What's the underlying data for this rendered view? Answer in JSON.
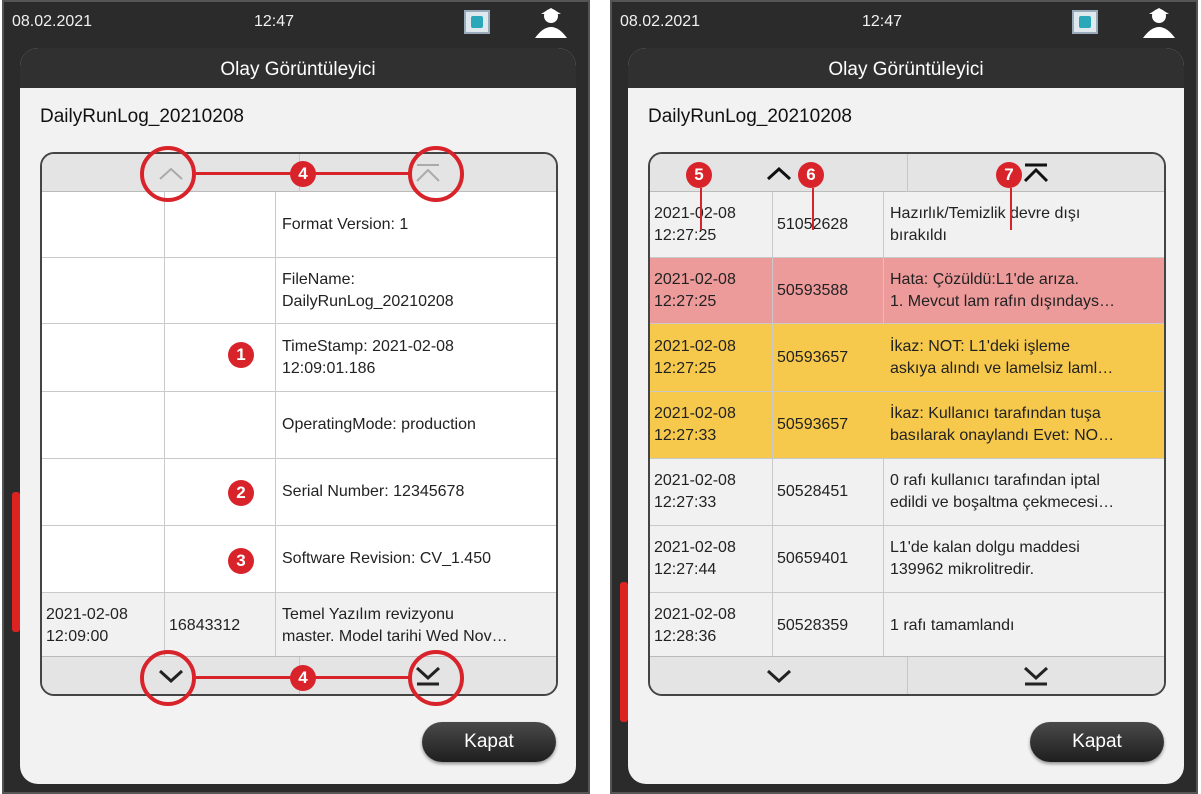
{
  "left": {
    "date": "08.02.2021",
    "time": "12:47",
    "title": "Olay Görüntüleyici",
    "log_name": "DailyRunLog_20210208",
    "rows": [
      {
        "c1a": "",
        "c1b": "",
        "c2": "",
        "c3a": "Format Version: 1",
        "c3b": ""
      },
      {
        "c1a": "",
        "c1b": "",
        "c2": "",
        "c3a": "FileName:",
        "c3b": "DailyRunLog_20210208"
      },
      {
        "c1a": "",
        "c1b": "",
        "c2": "",
        "c3a": "TimeStamp: 2021-02-08",
        "c3b": "12:09:01.186"
      },
      {
        "c1a": "",
        "c1b": "",
        "c2": "",
        "c3a": "OperatingMode: production",
        "c3b": ""
      },
      {
        "c1a": "",
        "c1b": "",
        "c2": "",
        "c3a": "Serial Number: 12345678",
        "c3b": ""
      },
      {
        "c1a": "",
        "c1b": "",
        "c2": "",
        "c3a": "Software Revision: CV_1.450",
        "c3b": ""
      },
      {
        "c1a": "2021-02-08",
        "c1b": "12:09:00",
        "c2": "16843312",
        "c3a": "Temel Yazılım revizyonu",
        "c3b": "master. Model tarihi Wed Nov…"
      }
    ],
    "callouts": [
      "1",
      "2",
      "3",
      "4",
      "4"
    ],
    "close_label": "Kapat"
  },
  "right": {
    "date": "08.02.2021",
    "time": "12:47",
    "title": "Olay Görüntüleyici",
    "log_name": "DailyRunLog_20210208",
    "rows": [
      {
        "c1a": "2021-02-08",
        "c1b": "12:27:25",
        "c2": "51052628",
        "c3a": "Hazırlık/Temizlik devre dışı",
        "c3b": "bırakıldı",
        "type": "normal"
      },
      {
        "c1a": "2021-02-08",
        "c1b": "12:27:25",
        "c2": "50593588",
        "c3a": "Hata: Çözüldü:L1'de arıza.",
        "c3b": "1. Mevcut lam rafın dışındays…",
        "type": "error"
      },
      {
        "c1a": "2021-02-08",
        "c1b": "12:27:25",
        "c2": "50593657",
        "c3a": "İkaz: NOT: L1'deki işleme",
        "c3b": "askıya alındı ve lamelsiz laml…",
        "type": "warn"
      },
      {
        "c1a": "2021-02-08",
        "c1b": "12:27:33",
        "c2": "50593657",
        "c3a": "İkaz: Kullanıcı tarafından tuşa",
        "c3b": "basılarak onaylandı Evet: NO…",
        "type": "warn"
      },
      {
        "c1a": "2021-02-08",
        "c1b": "12:27:33",
        "c2": "50528451",
        "c3a": "0 rafı kullanıcı tarafından iptal",
        "c3b": "edildi ve boşaltma çekmecesi…",
        "type": "normal"
      },
      {
        "c1a": "2021-02-08",
        "c1b": "12:27:44",
        "c2": "50659401",
        "c3a": "L1'de kalan dolgu maddesi",
        "c3b": "139962 mikrolitredir.",
        "type": "normal"
      },
      {
        "c1a": "2021-02-08",
        "c1b": "12:28:36",
        "c2": "50528359",
        "c3a": "1 rafı tamamlandı",
        "c3b": "",
        "type": "normal"
      }
    ],
    "callouts": [
      "5",
      "6",
      "7"
    ],
    "close_label": "Kapat"
  },
  "colors": {
    "error_row": "#ed9a9a",
    "warn_row": "#f6c94c",
    "callout": "#d8232a"
  }
}
